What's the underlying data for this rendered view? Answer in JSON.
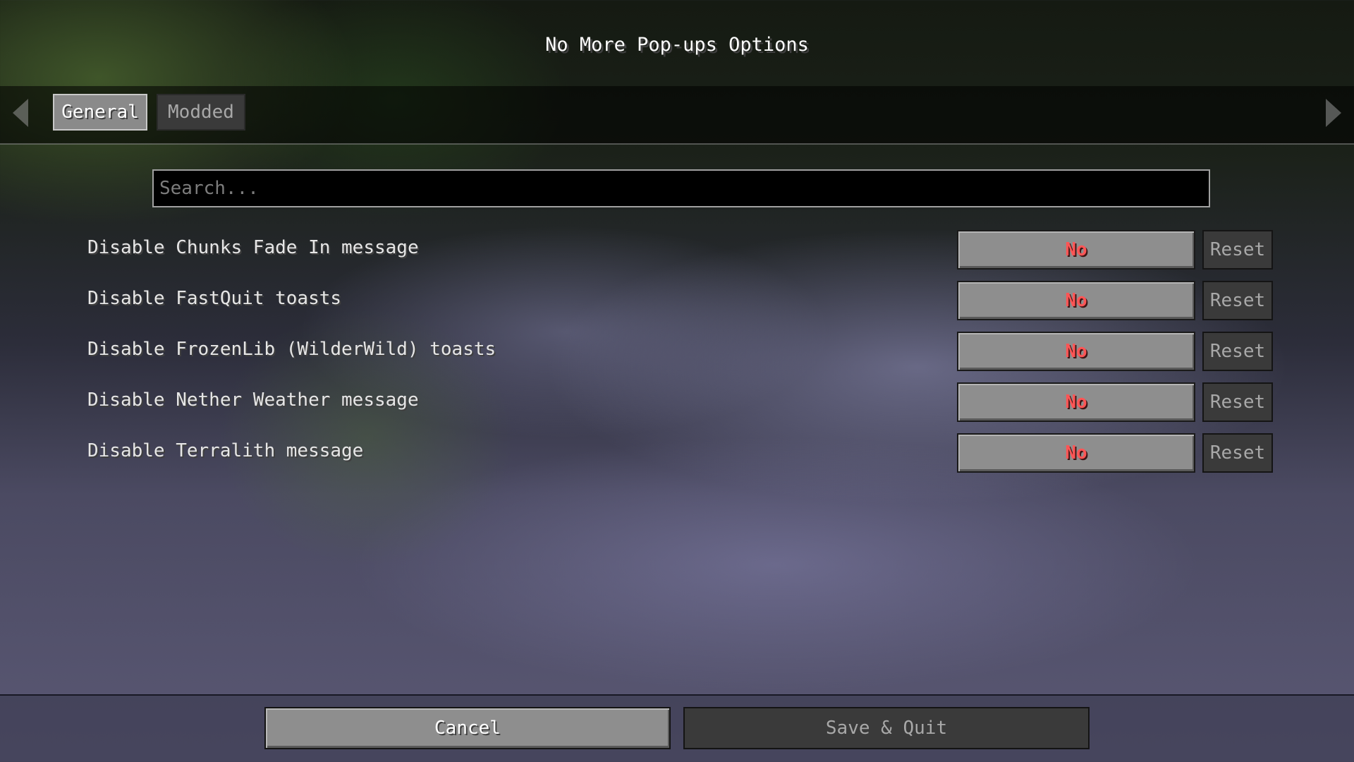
{
  "screen": {
    "title": "No More Pop-ups Options"
  },
  "tabs": [
    {
      "label": "General",
      "active": true
    },
    {
      "label": "Modded",
      "active": false
    }
  ],
  "search": {
    "placeholder": "Search...",
    "value": ""
  },
  "options": [
    {
      "label": "Disable Chunks Fade In message",
      "value": "No",
      "reset_label": "Reset"
    },
    {
      "label": "Disable FastQuit toasts",
      "value": "No",
      "reset_label": "Reset"
    },
    {
      "label": "Disable FrozenLib (WilderWild) toasts",
      "value": "No",
      "reset_label": "Reset"
    },
    {
      "label": "Disable Nether Weather message",
      "value": "No",
      "reset_label": "Reset"
    },
    {
      "label": "Disable Terralith message",
      "value": "No",
      "reset_label": "Reset"
    }
  ],
  "footer": {
    "cancel_label": "Cancel",
    "save_label": "Save & Quit"
  },
  "colors": {
    "value_off": "#ff5555",
    "label_text": "#e6e6e6",
    "disabled_text": "#a8a8a8"
  },
  "icons": {
    "prev_tab": "triangle-left-icon",
    "next_tab": "triangle-right-icon"
  }
}
